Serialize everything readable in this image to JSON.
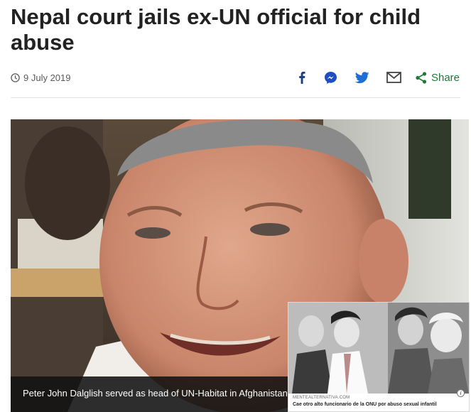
{
  "article": {
    "headline": "Nepal court jails ex-UN official for child abuse",
    "date": "9 July 2019"
  },
  "share": {
    "share_label": "Share",
    "icons": [
      "facebook-icon",
      "messenger-icon",
      "twitter-icon",
      "email-icon",
      "share-icon"
    ],
    "colors": {
      "icon_blue": "#1d3f8a",
      "share_green": "#1d7a36"
    }
  },
  "hero": {
    "caption": "Peter John Dalglish served as head of UN-Habitat in Afghanistan"
  },
  "ad": {
    "source": "MENTEALTERNATIVA.COM",
    "headline": "Cae otro alto funcionario de la ONU por abuso sexual infantil",
    "info_glyph": "i"
  }
}
